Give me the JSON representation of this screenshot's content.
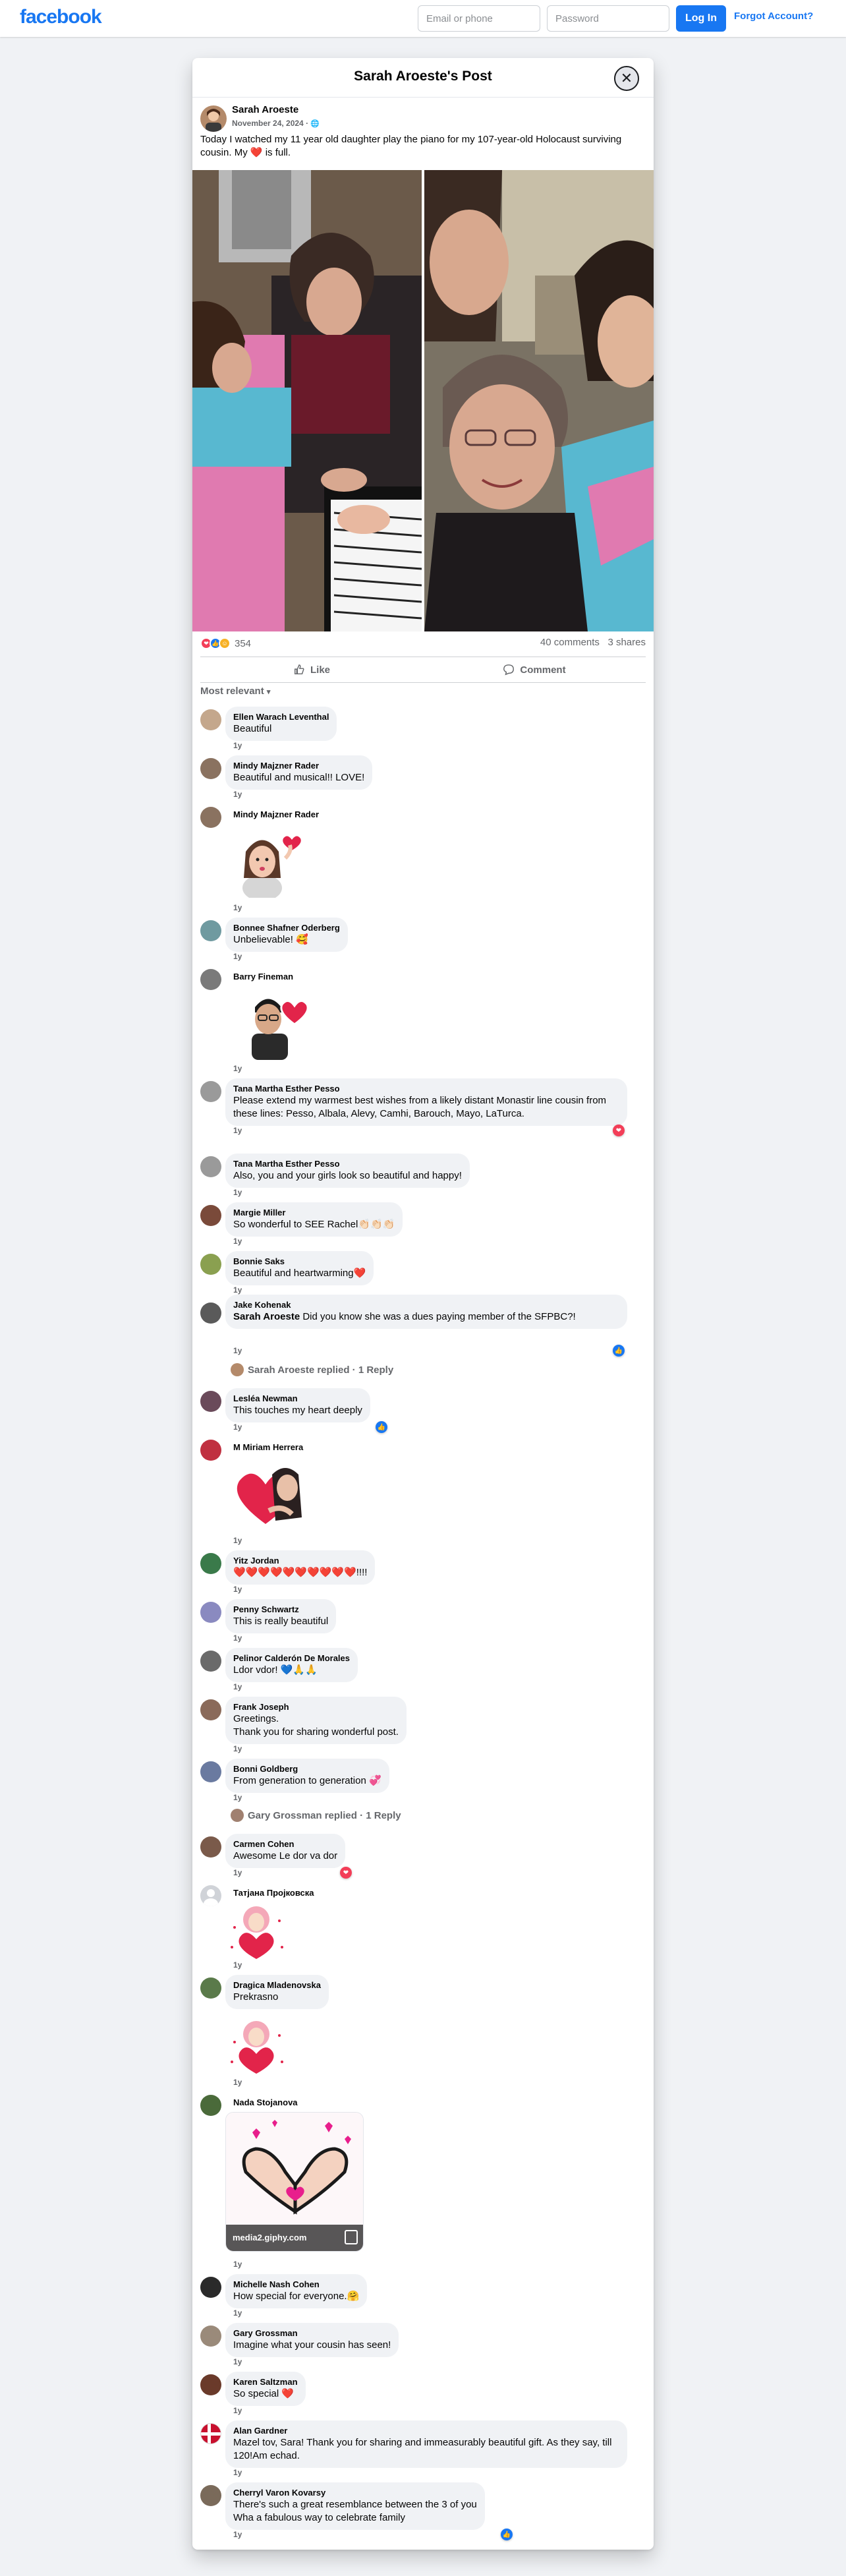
{
  "header": {
    "logo": "facebook",
    "email_placeholder": "Email or phone",
    "password_placeholder": "Password",
    "login": "Log In",
    "forgot": "Forgot Account?"
  },
  "modal": {
    "title": "Sarah Aroeste's Post",
    "close_icon": "close-icon"
  },
  "post": {
    "author": "Sarah Aroeste",
    "date": "November 24, 2024",
    "audience_icon": "globe-icon",
    "text_before": "Today I watched my 11 year old daughter play the piano for my 107-year-old Holocaust surviving cousin. My ",
    "text_after": " is full.",
    "reaction_count": "354",
    "comments": "40 comments",
    "shares": "3 shares",
    "like": "Like",
    "comment": "Comment",
    "sort": "Most relevant"
  },
  "colors": {
    "brand": "#1877f2",
    "love": "#f33e58",
    "like": "#1877f2",
    "care": "#f7b125"
  },
  "comments": [
    {
      "name": "Ellen Warach Leventhal",
      "text": "Beautiful",
      "time": "1y"
    },
    {
      "name": "Mindy Majzner Rader",
      "text": "Beautiful and musical!! LOVE!",
      "time": "1y"
    },
    {
      "name": "Mindy Majzner Rader",
      "time": "1y"
    },
    {
      "name": "Bonnee Shafner Oderberg",
      "text": "Unbelievable! 🥰",
      "time": "1y"
    },
    {
      "name": "Barry Fineman",
      "time": "1y"
    },
    {
      "name": "Tana Martha Esther Pesso",
      "text": "Please extend my warmest best wishes from a likely distant Monastir line cousin from these lines: Pesso, Albala, Alevy, Camhi, Barouch, Mayo, LaTurca.",
      "time": "1y"
    },
    {
      "name": "Tana Martha Esther Pesso",
      "text": "Also, you and your girls look so beautiful and happy!",
      "time": "1y"
    },
    {
      "name": "Margie Miller",
      "text": "So wonderful to SEE Rachel👏🏻👏🏻👏🏻",
      "time": "1y"
    },
    {
      "name": "Bonnie Saks",
      "text": "Beautiful and heartwarming❤️",
      "time": "1y"
    },
    {
      "name": "Jake Kohenak",
      "tag": "Sarah Aroeste",
      "text": " Did you know she was a dues paying member of the SFPBC?!",
      "time": "1y",
      "reply": "Sarah Aroeste replied · 1 Reply"
    },
    {
      "name": "Lesléa Newman",
      "text": "This touches my heart deeply",
      "time": "1y"
    },
    {
      "name": "M Miriam Herrera",
      "time": "1y"
    },
    {
      "name": "Yitz Jordan",
      "text": "❤️❤️❤️❤️❤️❤️❤️❤️❤️❤️!!!!",
      "time": "1y"
    },
    {
      "name": "Penny Schwartz",
      "text": "This is really beautiful",
      "time": "1y"
    },
    {
      "name": "Pelinor Calderón De Morales",
      "text": "Ldor vdor! 💙🙏🙏",
      "time": "1y"
    },
    {
      "name": "Frank Joseph",
      "text": "Greetings.",
      "text2": "Thank you for sharing wonderful post.",
      "time": "1y"
    },
    {
      "name": "Bonni Goldberg",
      "text": "From generation to generation 💞",
      "time": "1y",
      "reply": "Gary Grossman replied · 1 Reply"
    },
    {
      "name": "Carmen Cohen",
      "text": "Awesome Le dor va dor",
      "time": "1y"
    },
    {
      "name": "Татјана Пројковска",
      "time": "1y"
    },
    {
      "name": "Dragica Mladenovska",
      "text": "Prekrasno",
      "time": "1y"
    },
    {
      "name": "Nada Stojanova",
      "time": "1y",
      "gif_source": "media2.giphy.com"
    },
    {
      "name": "Michelle Nash Cohen",
      "text": "How special for everyone.🤗",
      "time": "1y"
    },
    {
      "name": "Gary Grossman",
      "text": "Imagine what your cousin has seen!",
      "time": "1y"
    },
    {
      "name": "Karen Saltzman",
      "text": "So special ❤️",
      "time": "1y"
    },
    {
      "name": "Alan Gardner",
      "text": "Mazel tov, Sara! Thank you for sharing and immeasurably beautiful gift. As they say, till 120!Am echad.",
      "time": "1y"
    },
    {
      "name": "Cherryl Varon Kovarsy",
      "text": "There's such a great resemblance between the 3 of you",
      "text2": "Wha a fabulous way to celebrate family",
      "time": "1y"
    }
  ]
}
